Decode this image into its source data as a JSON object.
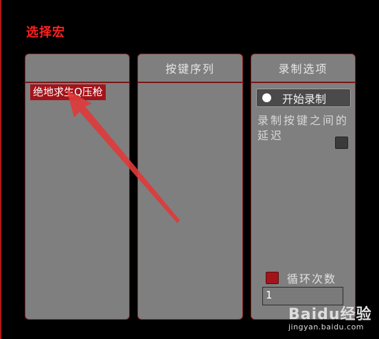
{
  "title": "选择宏",
  "panels": {
    "macros": {
      "header": "",
      "items": [
        "绝地求生Q压枪"
      ]
    },
    "sequence": {
      "header": "按键序列"
    },
    "options": {
      "header": "录制选项",
      "record_button": "开始录制",
      "delay_label": "录制按键之间的延迟",
      "loop_label": "循环次数",
      "loop_value": "1"
    }
  },
  "watermark": {
    "logo": "Baidu经验",
    "sub": "jingyan.baidu.com"
  },
  "colors": {
    "accent": "#ff2020",
    "selection": "#a3141a",
    "panel": "#7f7f7f",
    "border": "#8a1c1c"
  }
}
